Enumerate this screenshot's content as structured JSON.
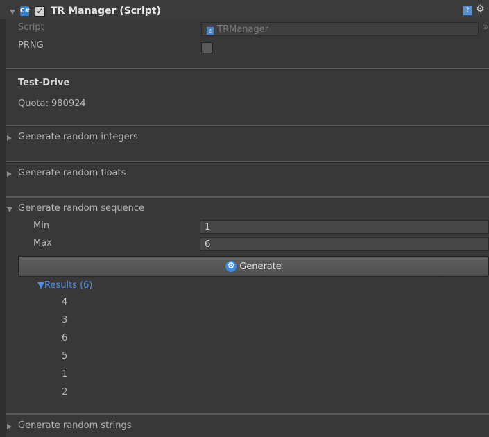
{
  "header": {
    "title": "TR Manager (Script)",
    "script_icon": "cs-script-icon",
    "help_icon": "help-book-icon",
    "settings_icon": "gear-icon"
  },
  "script_row": {
    "label": "Script",
    "value": "TRManager"
  },
  "prng_row": {
    "label": "PRNG",
    "checked": false
  },
  "testdrive": {
    "heading": "Test-Drive",
    "quota": "Quota: 980924"
  },
  "sections": {
    "integers": "Generate random integers",
    "floats": "Generate random floats",
    "sequence": "Generate random sequence",
    "strings": "Generate random strings"
  },
  "sequence": {
    "min_label": "Min",
    "min_value": "1",
    "max_label": "Max",
    "max_value": "6",
    "generate_label": "Generate",
    "results_label": "Results (6)",
    "results": [
      "4",
      "3",
      "6",
      "5",
      "1",
      "2"
    ]
  },
  "colors": {
    "background": "#383838",
    "accent": "#4d8fe8"
  }
}
